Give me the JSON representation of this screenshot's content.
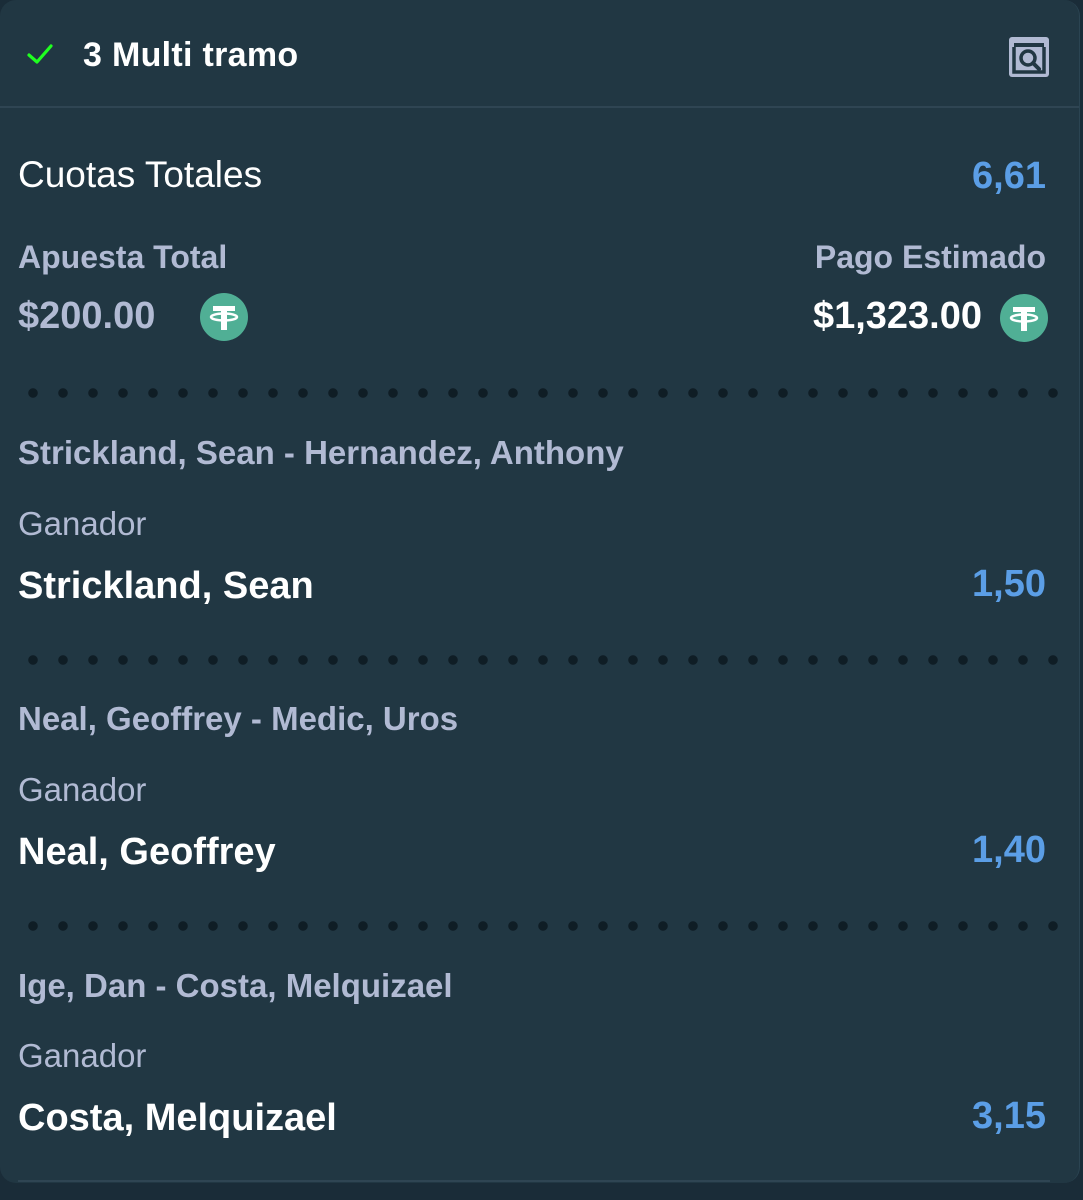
{
  "header": {
    "title": "3 Multi tramo",
    "status_icon": "check-icon",
    "status_color": "#1fff20",
    "action_icon": "receipt-search-icon"
  },
  "summary": {
    "total_odds_label": "Cuotas Totales",
    "total_odds_value": "6,61",
    "stake_label": "Apuesta Total",
    "stake_value": "$200.00",
    "payout_label": "Pago Estimado",
    "payout_value": "$1,323.00",
    "currency_icon": "tether-usdt-icon",
    "currency_color": "#50af95"
  },
  "legs": [
    {
      "event": "Strickland, Sean - Hernandez, Anthony",
      "market": "Ganador",
      "pick": "Strickland, Sean",
      "odds": "1,50"
    },
    {
      "event": "Neal, Geoffrey - Medic, Uros",
      "market": "Ganador",
      "pick": "Neal, Geoffrey",
      "odds": "1,40"
    },
    {
      "event": "Ige, Dan - Costa, Melquizael",
      "market": "Ganador",
      "pick": "Costa, Melquizael",
      "odds": "3,15"
    }
  ],
  "colors": {
    "background": "#213743",
    "accent_odds": "#5b9ee6",
    "muted_text": "#b1bad3"
  }
}
